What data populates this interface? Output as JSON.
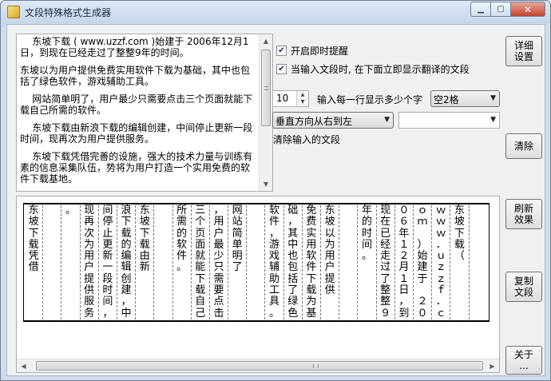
{
  "window": {
    "title": "文段特殊格式生成器",
    "controls": {
      "minimize": "▁",
      "maximize": "▢",
      "close": "✕"
    }
  },
  "source": {
    "paragraphs": [
      "    东坡下载 ( www.uzzf.com )始建于 2006年12月1日，到现在已经走过了整整9年的时间。",
      "东坡以为用户提供免费实用软件下载为基础，其中也包括了绿色软件，游戏辅助工具。",
      "    网站简单明了，用户最少只需要点击三个页面就能下载自己所需的软件。",
      "    东坡下载由新浪下载的编辑创建，中间停止更新一段时间，现再次为用户提供服务。",
      "    东坡下载凭借完善的设施，强大的技术力量与训练有素的信息采集队伍，势将为用户打造一个实用免费的软件下载基地。"
    ]
  },
  "options": {
    "instant_alert": {
      "label": "开启即时提醒",
      "checked": true
    },
    "show_translation": {
      "label": "当输入文段时, 在下面立即显示翻译的文段",
      "checked": true
    },
    "chars_per_line": {
      "value": "10",
      "label": "输入每一行显示多少个字"
    },
    "spacing": {
      "value": "空2格"
    },
    "direction": {
      "value": "垂直方向从右到左"
    },
    "extra": {
      "value": ""
    },
    "clear_label": "清除输入的文段"
  },
  "buttons": {
    "settings": "详细\n设置",
    "clear": "清除",
    "refresh": "刷新\n效果",
    "copy": "复制\n文段",
    "about": "关于\n..."
  },
  "output": {
    "columns_rtl": [
      "东坡下载（",
      "ｗｗｗ．ｕｚｚｆ．ｃ",
      "ｏｍ　）始建于　２０",
      "０６年１２月１日，到",
      "现在已经走过了整整９",
      "年的时间。",
      "",
      "东坡以为用户提供",
      "免费实用软件下载为基",
      "础，其中也包括了绿色",
      "软件，游戏辅助工具。",
      "",
      "网站简单明了",
      "，用户最少只需要点击",
      "三个页面就能下载自己",
      "所需的软件。",
      "",
      "东坡下载由新",
      "浪下载的编辑创建，中",
      "间停止更新一段时间，",
      "现再次为用户提供服务",
      "。",
      "",
      "东坡下载凭借"
    ]
  }
}
